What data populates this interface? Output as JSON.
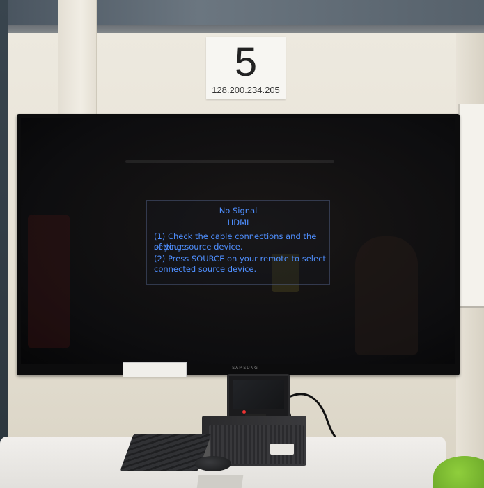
{
  "room_sign": {
    "number": "5",
    "ip_address": "128.200.234.205"
  },
  "tv_message": {
    "title": "No Signal",
    "source": "HDMI",
    "line1a": "(1) Check the cable connections and the settings",
    "line1b": "of your source device.",
    "line2a": "(2) Press SOURCE on your remote to select",
    "line2b": "connected source device."
  },
  "tv_brand": "SAMSUNG",
  "colors": {
    "message_text": "#4f8fff",
    "wall": "#ede9df"
  }
}
